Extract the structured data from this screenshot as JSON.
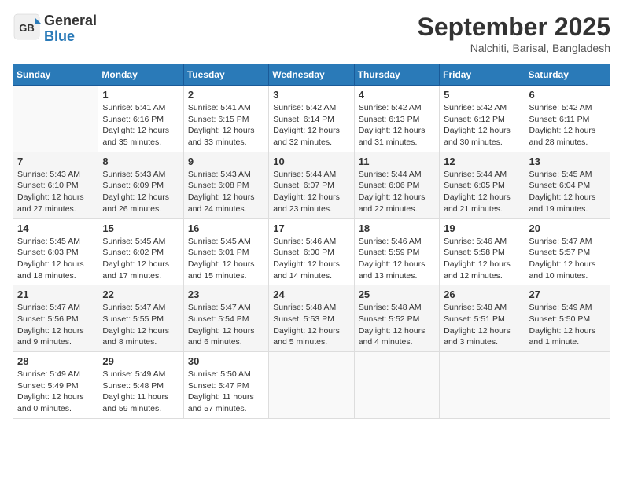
{
  "header": {
    "logo_general": "General",
    "logo_blue": "Blue",
    "month": "September 2025",
    "location": "Nalchiti, Barisal, Bangladesh"
  },
  "weekdays": [
    "Sunday",
    "Monday",
    "Tuesday",
    "Wednesday",
    "Thursday",
    "Friday",
    "Saturday"
  ],
  "weeks": [
    [
      {
        "day": "",
        "info": ""
      },
      {
        "day": "1",
        "info": "Sunrise: 5:41 AM\nSunset: 6:16 PM\nDaylight: 12 hours\nand 35 minutes."
      },
      {
        "day": "2",
        "info": "Sunrise: 5:41 AM\nSunset: 6:15 PM\nDaylight: 12 hours\nand 33 minutes."
      },
      {
        "day": "3",
        "info": "Sunrise: 5:42 AM\nSunset: 6:14 PM\nDaylight: 12 hours\nand 32 minutes."
      },
      {
        "day": "4",
        "info": "Sunrise: 5:42 AM\nSunset: 6:13 PM\nDaylight: 12 hours\nand 31 minutes."
      },
      {
        "day": "5",
        "info": "Sunrise: 5:42 AM\nSunset: 6:12 PM\nDaylight: 12 hours\nand 30 minutes."
      },
      {
        "day": "6",
        "info": "Sunrise: 5:42 AM\nSunset: 6:11 PM\nDaylight: 12 hours\nand 28 minutes."
      }
    ],
    [
      {
        "day": "7",
        "info": "Sunrise: 5:43 AM\nSunset: 6:10 PM\nDaylight: 12 hours\nand 27 minutes."
      },
      {
        "day": "8",
        "info": "Sunrise: 5:43 AM\nSunset: 6:09 PM\nDaylight: 12 hours\nand 26 minutes."
      },
      {
        "day": "9",
        "info": "Sunrise: 5:43 AM\nSunset: 6:08 PM\nDaylight: 12 hours\nand 24 minutes."
      },
      {
        "day": "10",
        "info": "Sunrise: 5:44 AM\nSunset: 6:07 PM\nDaylight: 12 hours\nand 23 minutes."
      },
      {
        "day": "11",
        "info": "Sunrise: 5:44 AM\nSunset: 6:06 PM\nDaylight: 12 hours\nand 22 minutes."
      },
      {
        "day": "12",
        "info": "Sunrise: 5:44 AM\nSunset: 6:05 PM\nDaylight: 12 hours\nand 21 minutes."
      },
      {
        "day": "13",
        "info": "Sunrise: 5:45 AM\nSunset: 6:04 PM\nDaylight: 12 hours\nand 19 minutes."
      }
    ],
    [
      {
        "day": "14",
        "info": "Sunrise: 5:45 AM\nSunset: 6:03 PM\nDaylight: 12 hours\nand 18 minutes."
      },
      {
        "day": "15",
        "info": "Sunrise: 5:45 AM\nSunset: 6:02 PM\nDaylight: 12 hours\nand 17 minutes."
      },
      {
        "day": "16",
        "info": "Sunrise: 5:45 AM\nSunset: 6:01 PM\nDaylight: 12 hours\nand 15 minutes."
      },
      {
        "day": "17",
        "info": "Sunrise: 5:46 AM\nSunset: 6:00 PM\nDaylight: 12 hours\nand 14 minutes."
      },
      {
        "day": "18",
        "info": "Sunrise: 5:46 AM\nSunset: 5:59 PM\nDaylight: 12 hours\nand 13 minutes."
      },
      {
        "day": "19",
        "info": "Sunrise: 5:46 AM\nSunset: 5:58 PM\nDaylight: 12 hours\nand 12 minutes."
      },
      {
        "day": "20",
        "info": "Sunrise: 5:47 AM\nSunset: 5:57 PM\nDaylight: 12 hours\nand 10 minutes."
      }
    ],
    [
      {
        "day": "21",
        "info": "Sunrise: 5:47 AM\nSunset: 5:56 PM\nDaylight: 12 hours\nand 9 minutes."
      },
      {
        "day": "22",
        "info": "Sunrise: 5:47 AM\nSunset: 5:55 PM\nDaylight: 12 hours\nand 8 minutes."
      },
      {
        "day": "23",
        "info": "Sunrise: 5:47 AM\nSunset: 5:54 PM\nDaylight: 12 hours\nand 6 minutes."
      },
      {
        "day": "24",
        "info": "Sunrise: 5:48 AM\nSunset: 5:53 PM\nDaylight: 12 hours\nand 5 minutes."
      },
      {
        "day": "25",
        "info": "Sunrise: 5:48 AM\nSunset: 5:52 PM\nDaylight: 12 hours\nand 4 minutes."
      },
      {
        "day": "26",
        "info": "Sunrise: 5:48 AM\nSunset: 5:51 PM\nDaylight: 12 hours\nand 3 minutes."
      },
      {
        "day": "27",
        "info": "Sunrise: 5:49 AM\nSunset: 5:50 PM\nDaylight: 12 hours\nand 1 minute."
      }
    ],
    [
      {
        "day": "28",
        "info": "Sunrise: 5:49 AM\nSunset: 5:49 PM\nDaylight: 12 hours\nand 0 minutes."
      },
      {
        "day": "29",
        "info": "Sunrise: 5:49 AM\nSunset: 5:48 PM\nDaylight: 11 hours\nand 59 minutes."
      },
      {
        "day": "30",
        "info": "Sunrise: 5:50 AM\nSunset: 5:47 PM\nDaylight: 11 hours\nand 57 minutes."
      },
      {
        "day": "",
        "info": ""
      },
      {
        "day": "",
        "info": ""
      },
      {
        "day": "",
        "info": ""
      },
      {
        "day": "",
        "info": ""
      }
    ]
  ]
}
